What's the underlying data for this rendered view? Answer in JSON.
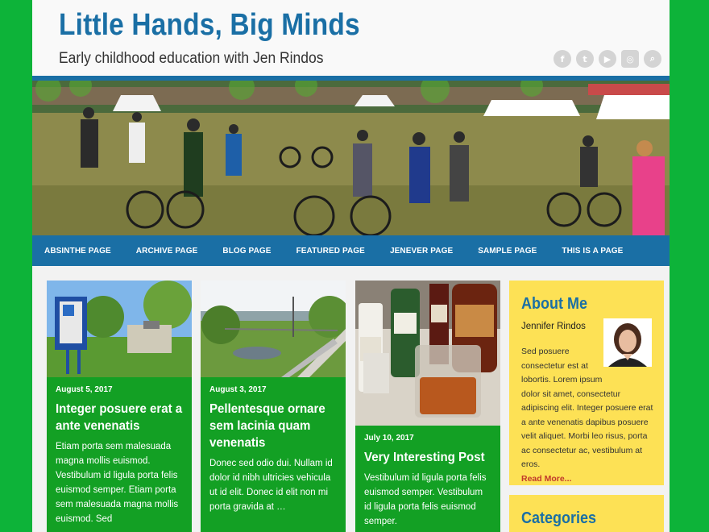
{
  "site": {
    "title": "Little Hands, Big Minds",
    "description": "Early childhood education with Jen Rindos"
  },
  "social_icons": [
    "facebook-icon",
    "twitter-icon",
    "youtube-icon",
    "instagram-icon",
    "search-icon"
  ],
  "nav": [
    "ABSINTHE PAGE",
    "ARCHIVE PAGE",
    "BLOG PAGE",
    "FEATURED PAGE",
    "JENEVER PAGE",
    "SAMPLE PAGE",
    "THIS IS A PAGE"
  ],
  "posts": [
    {
      "date": "August 5, 2017",
      "title": "Integer posuere erat a ante venenatis",
      "excerpt": "Etiam porta sem malesuada magna mollis euismod. Vestibulum id ligula porta felis euismod semper. Etiam porta sem malesuada magna mollis euismod. Sed"
    },
    {
      "date": "August 3, 2017",
      "title": "Pellentesque ornare sem lacinia quam venenatis",
      "excerpt": "Donec sed odio dui. Nullam id dolor id nibh ultricies vehicula ut id elit. Donec id elit non mi porta gravida at …"
    },
    {
      "date": "July 10, 2017",
      "title": "Very Interesting Post",
      "excerpt": "Vestibulum id ligula porta felis euismod semper. Vestibulum id ligula porta felis euismod semper."
    }
  ],
  "about": {
    "heading": "About Me",
    "name": "Jennifer Rindos",
    "bio": "Sed posuere consectetur est at lobortis. Lorem ipsum dolor sit amet, consectetur adipiscing elit. Integer posuere erat a ante venenatis dapibus posuere velit aliquet. Morbi leo risus, porta ac consectetur ac, vestibulum at eros.",
    "read_more": "Read More..."
  },
  "categories_heading": "Categories",
  "colors": {
    "background": "#0db339",
    "brand_blue": "#1a6fa5",
    "card_green": "#13a024",
    "sidebar_yellow": "#fde155"
  }
}
